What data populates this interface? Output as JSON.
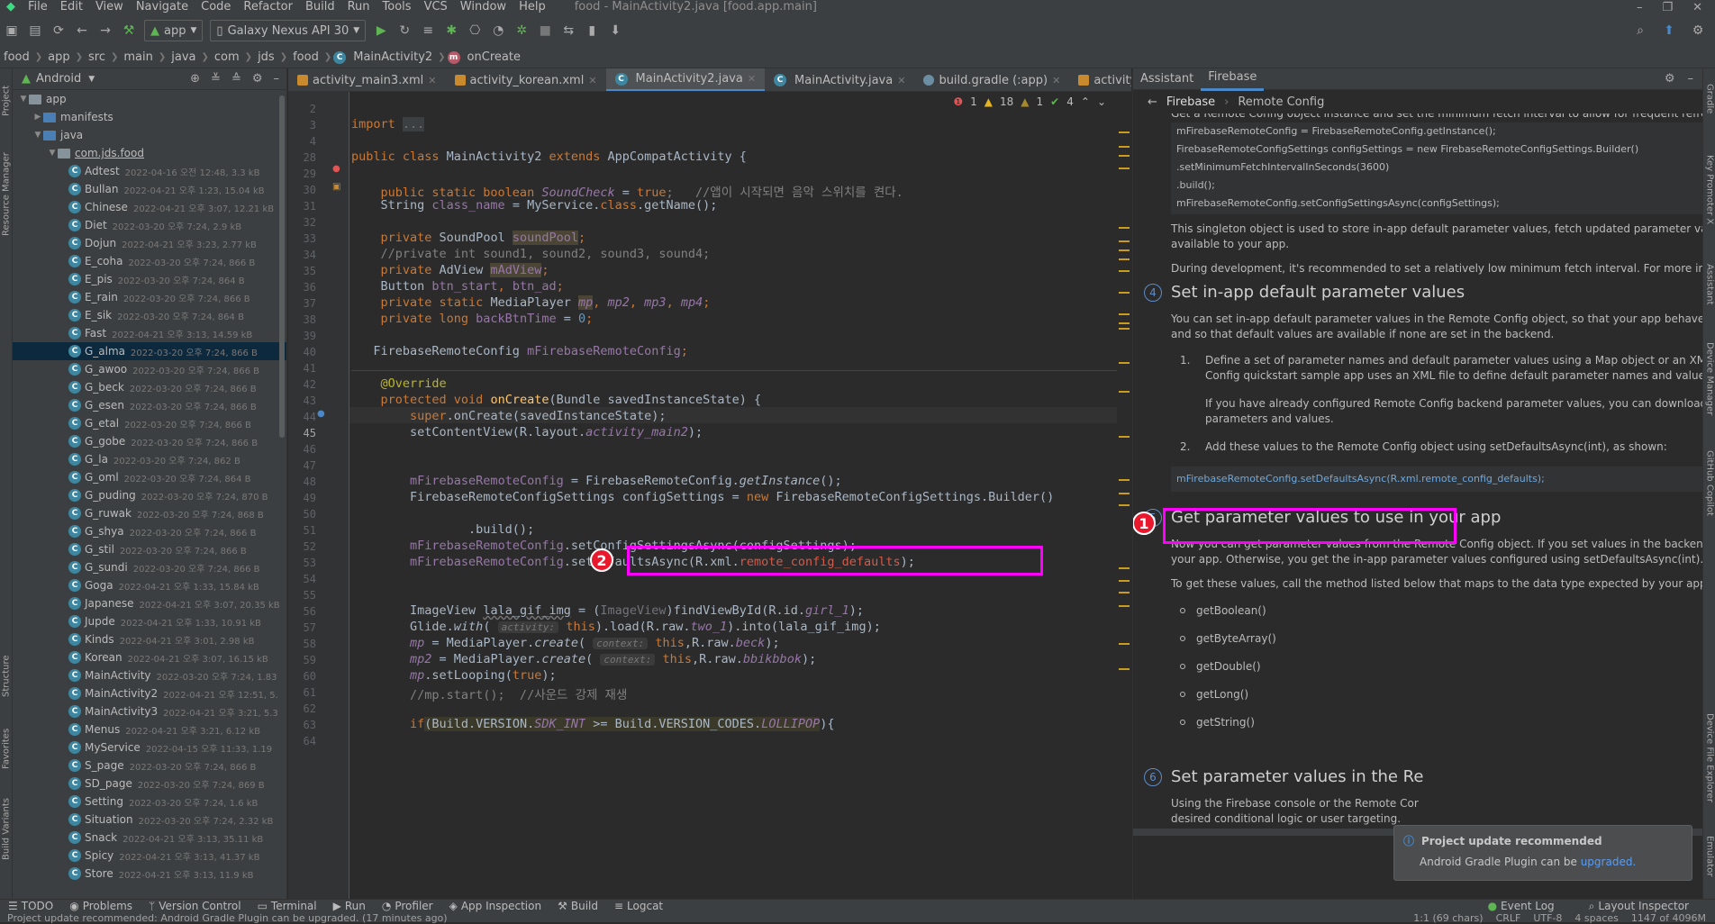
{
  "menu": {
    "items": [
      "File",
      "Edit",
      "View",
      "Navigate",
      "Code",
      "Refactor",
      "Build",
      "Run",
      "Tools",
      "VCS",
      "Window",
      "Help"
    ],
    "title": "food - MainActivity2.java [food.app.main]"
  },
  "toolbar": {
    "module": "app",
    "device": "Galaxy Nexus API 30"
  },
  "breadcrumbs": [
    "food",
    "app",
    "src",
    "main",
    "java",
    "com",
    "jds",
    "food",
    "MainActivity2",
    "onCreate"
  ],
  "project": {
    "view": "Android",
    "nodes": [
      {
        "label": "app",
        "type": "folder",
        "depth": 0,
        "open": true
      },
      {
        "label": "manifests",
        "type": "folder",
        "depth": 1,
        "open": false
      },
      {
        "label": "java",
        "type": "folder",
        "depth": 1,
        "open": true
      },
      {
        "label": "com.jds.food",
        "type": "package",
        "depth": 2,
        "open": true
      }
    ],
    "files": [
      {
        "name": "Adtest",
        "meta": "2022-04-16 오전 12:48, 3.3 kB"
      },
      {
        "name": "Bullan",
        "meta": "2022-04-21 오후 1:23, 15.04 kB"
      },
      {
        "name": "Chinese",
        "meta": "2022-04-21 오후 3:07, 12.21 kB"
      },
      {
        "name": "Diet",
        "meta": "2022-03-20 오후 7:24, 2.9 kB"
      },
      {
        "name": "Dojun",
        "meta": "2022-04-21 오후 3:23, 2.77 kB"
      },
      {
        "name": "E_coha",
        "meta": "2022-03-20 오후 7:24, 866 B"
      },
      {
        "name": "E_pis",
        "meta": "2022-03-20 오후 7:24, 864 B"
      },
      {
        "name": "E_rain",
        "meta": "2022-03-20 오후 7:24, 866 B"
      },
      {
        "name": "E_sik",
        "meta": "2022-03-20 오후 7:24, 864 B"
      },
      {
        "name": "Fast",
        "meta": "2022-04-21 오후 3:13, 14.59 kB"
      },
      {
        "name": "G_alma",
        "meta": "2022-03-20 오후 7:24, 866 B"
      },
      {
        "name": "G_awoo",
        "meta": "2022-03-20 오후 7:24, 866 B"
      },
      {
        "name": "G_beck",
        "meta": "2022-03-20 오후 7:24, 866 B"
      },
      {
        "name": "G_esen",
        "meta": "2022-03-20 오후 7:24, 866 B"
      },
      {
        "name": "G_etal",
        "meta": "2022-03-20 오후 7:24, 866 B"
      },
      {
        "name": "G_gobe",
        "meta": "2022-03-20 오후 7:24, 866 B"
      },
      {
        "name": "G_la",
        "meta": "2022-03-20 오후 7:24, 862 B"
      },
      {
        "name": "G_oml",
        "meta": "2022-03-20 오후 7:24, 864 B"
      },
      {
        "name": "G_puding",
        "meta": "2022-03-20 오후 7:24, 870 B"
      },
      {
        "name": "G_ruwak",
        "meta": "2022-03-20 오후 7:24, 868 B"
      },
      {
        "name": "G_shya",
        "meta": "2022-03-20 오후 7:24, 866 B"
      },
      {
        "name": "G_stil",
        "meta": "2022-03-20 오후 7:24, 866 B"
      },
      {
        "name": "G_sundi",
        "meta": "2022-03-20 오후 7:24, 866 B"
      },
      {
        "name": "Goga",
        "meta": "2022-04-21 오후 1:33, 15.84 kB"
      },
      {
        "name": "Japanese",
        "meta": "2022-04-21 오후 3:07, 20.35 kB"
      },
      {
        "name": "Jupde",
        "meta": "2022-04-21 오후 1:33, 10.91 kB"
      },
      {
        "name": "Kinds",
        "meta": "2022-04-21 오후 3:01, 2.98 kB"
      },
      {
        "name": "Korean",
        "meta": "2022-04-21 오후 3:07, 16.15 kB"
      },
      {
        "name": "MainActivity",
        "meta": "2022-03-20 오후 7:24, 1.83"
      },
      {
        "name": "MainActivity2",
        "meta": "2022-04-21 오후 12:51, 5."
      },
      {
        "name": "MainActivity3",
        "meta": "2022-04-21 오후 3:21, 5.3"
      },
      {
        "name": "Menus",
        "meta": "2022-04-21 오후 3:21, 6.12 kB"
      },
      {
        "name": "MyService",
        "meta": "2022-04-15 오후 11:33, 1.19"
      },
      {
        "name": "S_page",
        "meta": "2022-03-20 오후 7:24, 866 B"
      },
      {
        "name": "SD_page",
        "meta": "2022-03-20 오후 7:24, 869 B"
      },
      {
        "name": "Setting",
        "meta": "2022-03-20 오후 7:24, 1.6 kB"
      },
      {
        "name": "Situation",
        "meta": "2022-03-20 오후 7:24, 2.32 kB"
      },
      {
        "name": "Snack",
        "meta": "2022-04-21 오후 3:13, 35.11 kB"
      },
      {
        "name": "Spicy",
        "meta": "2022-04-21 오후 3:13, 41.37 kB"
      },
      {
        "name": "Store",
        "meta": "2022-04-21 오후 3:13, 11.9 kB"
      }
    ],
    "selected": "G_alma"
  },
  "tabs": [
    "activity_main3.xml",
    "activity_korean.xml",
    "MainActivity2.java",
    "MainActivity.java",
    "build.gradle (:app)",
    "activity_main2.xml"
  ],
  "active_tab": "MainActivity2.java",
  "inspections": {
    "errors": "1",
    "warnings": "18",
    "weak": "1",
    "ok": "4"
  },
  "line_numbers": [
    "2",
    "3",
    "4",
    "28",
    "29",
    "30",
    "31",
    "32",
    "33",
    "34",
    "35",
    "36",
    "37",
    "38",
    "39",
    "40",
    "41",
    "42",
    "43",
    "44",
    "45",
    "46",
    "47",
    "48",
    "49",
    "50",
    "51",
    "52",
    "53",
    "54",
    "55",
    "56",
    "57",
    "58",
    "59",
    "60",
    "61",
    "62",
    "63",
    "64"
  ],
  "code": {
    "l2": "",
    "l3": "",
    "l4a": "import ",
    "l4b": "...",
    "l29a": "public class ",
    "l29b": "MainActivity2 ",
    "l29c": "extends ",
    "l29d": "AppCompatActivity {",
    "l31a": "    public static boolean ",
    "l31b": "SoundCheck",
    "l31c": " = ",
    "l31d": "true",
    "l31e": ";   //앱이 시작되면 음악 스위치를 켠다.",
    "l32a": "    String ",
    "l32b": "class_name",
    "l32c": " = MyService.",
    "l32d": "class",
    "l32e": ".getName();",
    "l34a": "    private ",
    "l34b": "SoundPool ",
    "l34c": "soundPool",
    "l34d": ";",
    "l35": "    //private int sound1, sound2, sound3, sound4;",
    "l36a": "    private ",
    "l36b": "AdView ",
    "l36c": "mAdView",
    "l36d": ";",
    "l37a": "    Button ",
    "l37b": "btn_start",
    "l37c": ", ",
    "l37d": "btn_ad",
    "l37e": ";",
    "l38a": "    private static ",
    "l38b": "MediaPlayer ",
    "l38c": "mp",
    "l38d": ", ",
    "l38e": "mp2",
    "l38f": ", ",
    "l38g": "mp3",
    "l38h": ", ",
    "l38i": "mp4",
    "l38j": ";",
    "l39a": "    private long ",
    "l39b": "backBtnTime",
    "l39c": " = ",
    "l39d": "0",
    "l39e": ";",
    "l41a": "   FirebaseRemoteConfig ",
    "l41b": "mFirebaseRemoteConfig",
    "l41c": ";",
    "l43": "    @Override",
    "l44a": "    protected void ",
    "l44b": "onCreate",
    "l44c": "(Bundle savedInstanceState) {",
    "l45a": "        ",
    "l45b": "super",
    "l45c": ".onCreate(savedInstanceState);",
    "l46a": "        setContentView(R.layout.",
    "l46b": "activity_main2",
    "l46c": ");",
    "l49a": "        ",
    "l49b": "mFirebaseRemoteConfig",
    "l49c": " = FirebaseRemoteConfig.",
    "l49d": "getInstance",
    "l49e": "();",
    "l50a": "        FirebaseRemoteConfigSettings configSettings = ",
    "l50b": "new ",
    "l50c": "FirebaseRemoteConfigSettings.Builder()",
    "l52": "                .build();",
    "l53a": "        ",
    "l53b": "mFirebaseRemoteConfig",
    "l53c": ".setConfigSettingsAsync(configSettings);",
    "l54a": "        ",
    "l54b": "mFirebaseRemoteConfig",
    "l54c": ".setDefaultsAsync(R.xml.",
    "l54d": "remote_config_defaults",
    "l54e": ");",
    "l56a": "        ImageView ",
    "l56b": "lala_gif_img",
    "l56c": " = (",
    "l56d": "ImageView",
    "l56e": ")findViewById(R.id.",
    "l56f": "girl_1",
    "l56g": ");",
    "l57a": "        Glide.",
    "l57b": "with",
    "l57c": "( ",
    "l57d": "activity:",
    "l57e": " this",
    "l57f": ").load(R.raw.",
    "l57g": "two_1",
    "l57h": ").into(lala_gif_img);",
    "l58a": "        ",
    "l58b": "mp",
    "l58c": " = MediaPlayer.",
    "l58d": "create",
    "l58e": "( ",
    "l58f": "context:",
    "l58g": " this",
    "l58h": ",R.raw.",
    "l58i": "beck",
    "l58j": ");",
    "l59a": "        ",
    "l59b": "mp2",
    "l59c": " = MediaPlayer.",
    "l59d": "create",
    "l59e": "( ",
    "l59f": "context:",
    "l59g": " this",
    "l59h": ",R.raw.",
    "l59i": "bbikbbok",
    "l59j": ");",
    "l60a": "        ",
    "l60b": "mp",
    "l60c": ".setLooping(",
    "l60d": "true",
    "l60e": ");",
    "l61": "        //mp.start();  //사운드 강제 재생",
    "l63a": "        if",
    "l63b": "(Build.VERSION.",
    "l63c": "SDK_INT",
    "l63d": " >= Build.VERSION_CODES.",
    "l63e": "LOLLIPOP",
    "l63f": "){"
  },
  "badges": {
    "b1": "1",
    "b2": "2"
  },
  "assistant": {
    "tabs": [
      "Assistant",
      "Firebase"
    ],
    "back": "Firebase",
    "crumb": "Remote Config",
    "intro": "Get a Remote Config object instance and set the minimum fetch interval to allow for frequent refreshes:",
    "code1": [
      "mFirebaseRemoteConfig = FirebaseRemoteConfig.getInstance();",
      "FirebaseRemoteConfigSettings configSettings = new FirebaseRemoteConfigSettings.Builder()",
      "        .setMinimumFetchIntervalInSeconds(3600)",
      "        .build();",
      "mFirebaseRemoteConfig.setConfigSettingsAsync(configSettings);"
    ],
    "p1a": "This singleton object is used to store in-app default parameter values, fetch updated parameter values from the",
    "p1b": "available to your app.",
    "p2": "During development, it's recommended to set a relatively low minimum fetch interval. For more information,",
    "step4_num": "4",
    "step4": "Set in-app default parameter values",
    "p3a": "You can set in-app default parameter values in the Remote Config object, so that your app behaves as intend",
    "p3b": "and so that default values are available if none are set in the backend.",
    "li1num": "1.",
    "li1a": "Define a set of parameter names and default parameter values using a Map object or an XML resource",
    "li1b": "Config quickstart sample app uses an XML file to define default parameter names and values.",
    "li1c": "If you have already configured Remote Config backend parameter values, you can download a pre-ge",
    "li1d": "parameters and values.",
    "li2num": "2.",
    "li2": "Add these values to the Remote Config object using setDefaultsAsync(int), as shown:",
    "code2": "mFirebaseRemoteConfig.setDefaultsAsync(R.xml.remote_config_defaults);",
    "step5_num": "5",
    "step5": "Get parameter values to use in your app",
    "p4a": "Now you can get parameter values from the Remote Config object. If you set values in the backend, fetch th",
    "p4b": "your app. Otherwise, you get the in-app parameter values configured using setDefaultsAsync(int).",
    "p5": "To get these values, call the method listed below that maps to the data type expected by your app, providing",
    "methods": [
      "getBoolean()",
      "getByteArray()",
      "getDouble()",
      "getLong()",
      "getString()"
    ],
    "step6_num": "6",
    "step6": "Set parameter values in the Re",
    "p6a": "Using the Firebase console or the Remote Cor",
    "p6b": "desired conditional logic or user targeting."
  },
  "popup": {
    "title": "Project update recommended",
    "text": "Android Gradle Plugin can be",
    "link": "upgraded."
  },
  "left_strip": [
    "Project",
    "Resource Manager",
    "Structure",
    "Favorites",
    "Build Variants"
  ],
  "right_strip": [
    "Gradle",
    "Key Promoter X",
    "Assistant",
    "Device Manager",
    "GitHub Copilot",
    "Device File Explorer",
    "Emulator"
  ],
  "toolwindows": [
    "TODO",
    "Problems",
    "Version Control",
    "Terminal",
    "Run",
    "Profiler",
    "App Inspection",
    "Build",
    "Logcat"
  ],
  "right_tools": [
    "Event Log",
    "Layout Inspector"
  ],
  "status": {
    "message": "Project update recommended: Android Gradle Plugin can be upgraded. (17 minutes ago)",
    "position": "1:1 (69 chars)",
    "eol": "CRLF",
    "encoding": "UTF-8",
    "indent": "4 spaces",
    "memory": "1147 of 4096M"
  },
  "colors": {
    "highlight": "#ff00ff",
    "badge": "#e8192c",
    "accent": "#4a88c7"
  }
}
